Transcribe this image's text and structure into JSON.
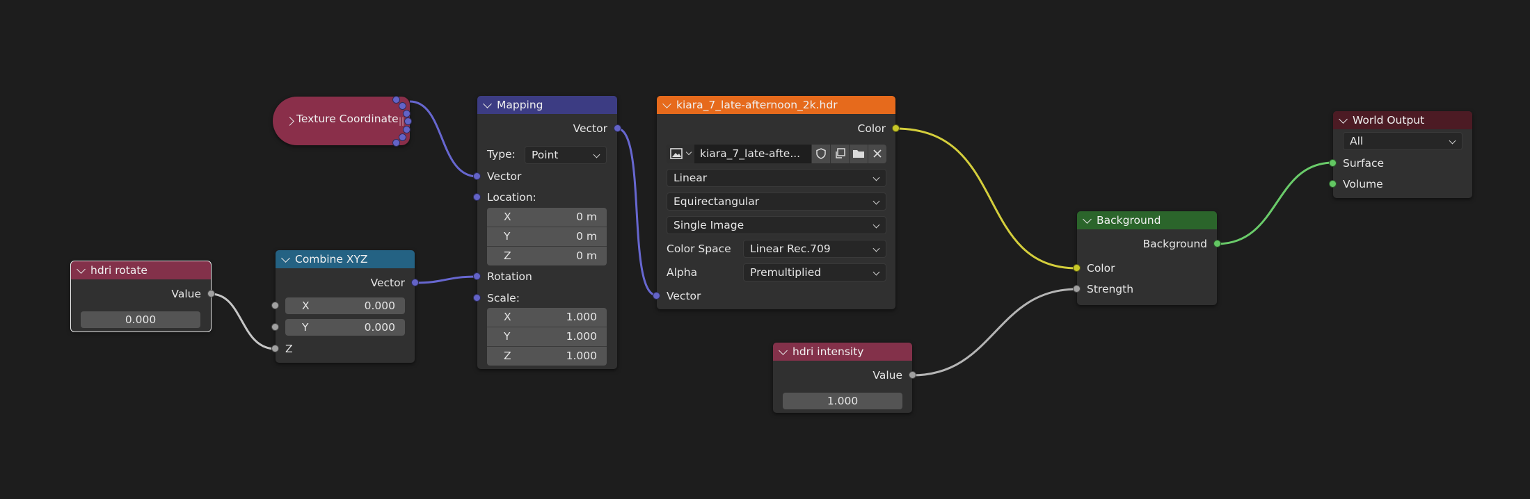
{
  "colors": {
    "background": "#1d1d1d",
    "node_body": "#303030",
    "header_input": "#83314a",
    "header_converter": "#246283",
    "header_vector": "#3c3c83",
    "header_texture": "#e66a1c",
    "header_shader": "#2b652b",
    "header_output": "#4c1b24",
    "socket_vector": "#6363c7",
    "socket_float": "#a1a1a1",
    "socket_color": "#c7c729",
    "socket_shader": "#63c763"
  },
  "nodes": {
    "hdri_rotate": {
      "title": "hdri rotate",
      "output_label": "Value",
      "value": "0.000"
    },
    "combine_xyz": {
      "title": "Combine XYZ",
      "output_label": "Vector",
      "x_label": "X",
      "x_value": "0.000",
      "y_label": "Y",
      "y_value": "0.000",
      "z_label": "Z"
    },
    "texture_coordinate": {
      "title": "Texture Coordinate"
    },
    "mapping": {
      "title": "Mapping",
      "output_label": "Vector",
      "type_label": "Type:",
      "type_value": "Point",
      "vector_label": "Vector",
      "location_label": "Location:",
      "location": [
        {
          "axis": "X",
          "value": "0 m"
        },
        {
          "axis": "Y",
          "value": "0 m"
        },
        {
          "axis": "Z",
          "value": "0 m"
        }
      ],
      "rotation_label": "Rotation",
      "scale_label": "Scale:",
      "scale": [
        {
          "axis": "X",
          "value": "1.000"
        },
        {
          "axis": "Y",
          "value": "1.000"
        },
        {
          "axis": "Z",
          "value": "1.000"
        }
      ]
    },
    "environment_texture": {
      "title": "kiara_7_late-afternoon_2k.hdr",
      "output_label": "Color",
      "image_name": "kiara_7_late-afte...",
      "interpolation": "Linear",
      "projection": "Equirectangular",
      "source": "Single Image",
      "color_space_label": "Color Space",
      "color_space_value": "Linear Rec.709",
      "alpha_label": "Alpha",
      "alpha_value": "Premultiplied",
      "vector_label": "Vector"
    },
    "hdri_intensity": {
      "title": "hdri intensity",
      "output_label": "Value",
      "value": "1.000"
    },
    "background": {
      "title": "Background",
      "output_label": "Background",
      "color_label": "Color",
      "strength_label": "Strength"
    },
    "world_output": {
      "title": "World Output",
      "target": "All",
      "surface_label": "Surface",
      "volume_label": "Volume"
    }
  }
}
